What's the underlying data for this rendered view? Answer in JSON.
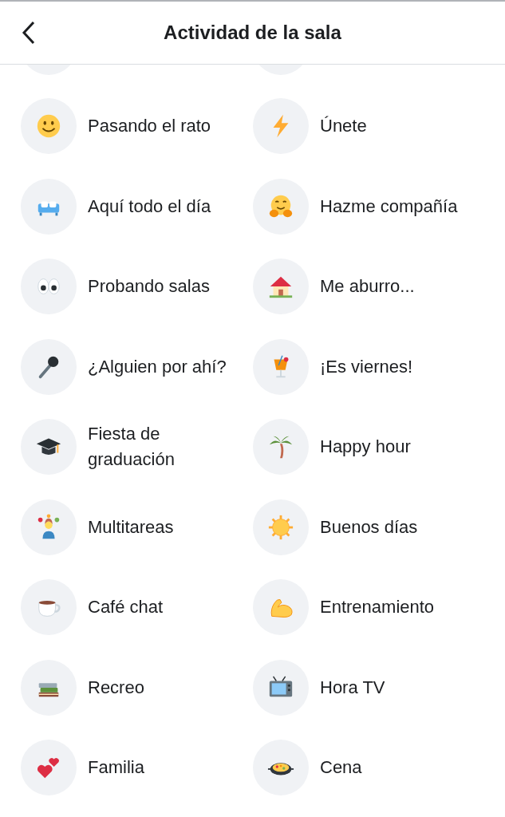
{
  "header": {
    "title": "Actividad de la sala"
  },
  "activities": [
    {
      "label": "Pasando el rato"
    },
    {
      "label": "Únete"
    },
    {
      "label": "Aquí todo el día"
    },
    {
      "label": "Hazme compañía"
    },
    {
      "label": "Probando salas"
    },
    {
      "label": "Me aburro..."
    },
    {
      "label": "¿Alguien por ahí?"
    },
    {
      "label": "¡Es viernes!"
    },
    {
      "label": "Fiesta de graduación"
    },
    {
      "label": "Happy hour"
    },
    {
      "label": "Multitareas"
    },
    {
      "label": "Buenos días"
    },
    {
      "label": "Café chat"
    },
    {
      "label": "Entrenamiento"
    },
    {
      "label": "Recreo"
    },
    {
      "label": "Hora TV"
    },
    {
      "label": "Familia"
    },
    {
      "label": "Cena"
    }
  ]
}
